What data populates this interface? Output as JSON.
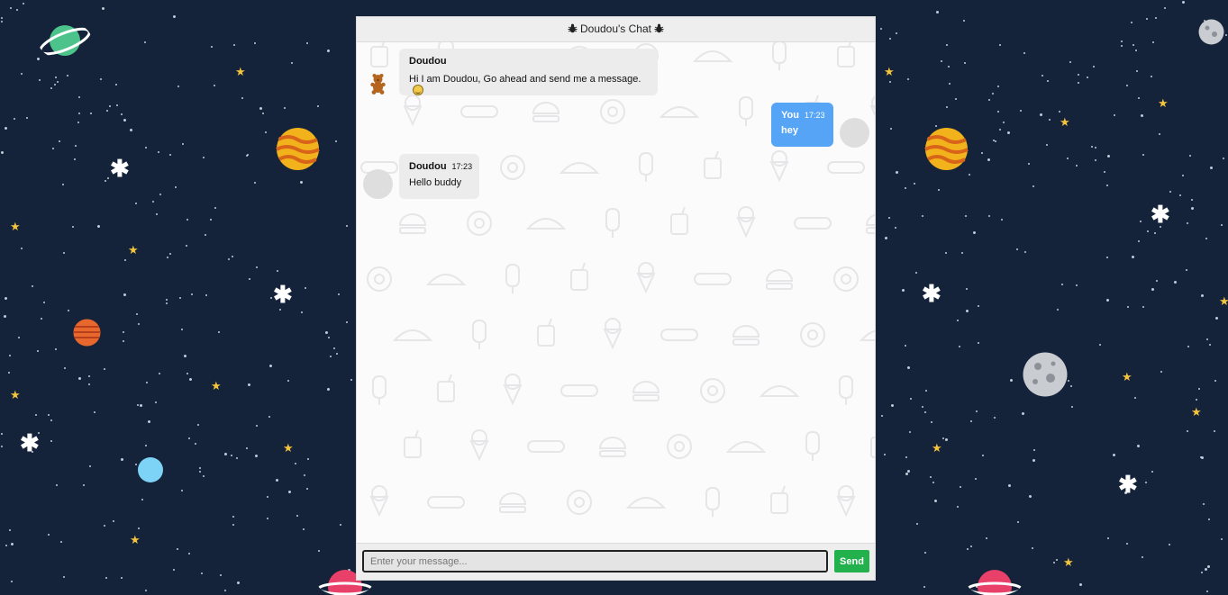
{
  "colors": {
    "space_background": "#14233a",
    "incoming_bubble": "#ececec",
    "outgoing_bubble": "#55a4f5",
    "send_button": "#22b14c",
    "header_background": "#eeeeee"
  },
  "chat": {
    "title": "Doudou's Chat",
    "title_icon": "bug-icon",
    "messages": [
      {
        "sender": "Doudou",
        "time": "",
        "text": "Hi I am Doudou, Go ahead and send me a message.",
        "emoji": "grinning-face-icon",
        "direction": "incoming",
        "avatar": "teddy-bear-icon"
      },
      {
        "sender": "You",
        "time": "17:23",
        "text": "hey",
        "direction": "outgoing",
        "avatar": "blank-avatar"
      },
      {
        "sender": "Doudou",
        "time": "17:23",
        "text": "Hello buddy",
        "direction": "incoming",
        "avatar": "blank-avatar"
      }
    ]
  },
  "composer": {
    "placeholder": "Enter your message...",
    "value": "",
    "send_label": "Send"
  }
}
